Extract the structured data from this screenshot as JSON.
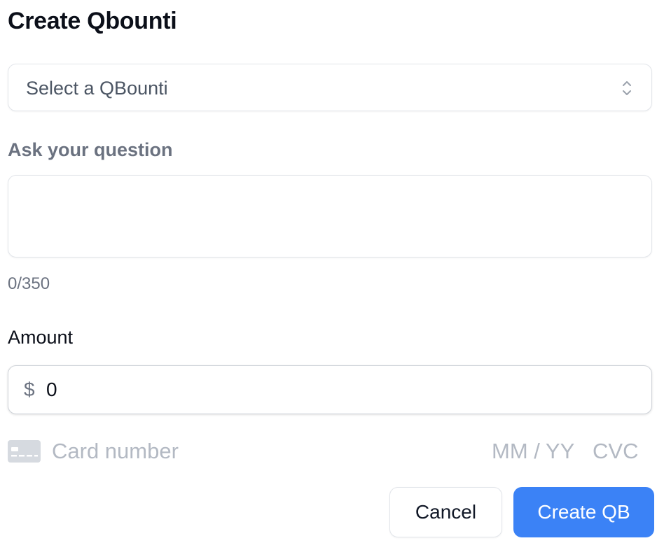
{
  "modal": {
    "title": "Create Qbounti"
  },
  "qbounti_select": {
    "selected": "Select a QBounti",
    "icon": "chevron-up-down-icon"
  },
  "question": {
    "label": "Ask your question",
    "value": "",
    "placeholder": "",
    "counter": "0/350"
  },
  "amount": {
    "label": "Amount",
    "currency_symbol": "$",
    "value": "0"
  },
  "card": {
    "icon": "credit-card-icon",
    "number_placeholder": "Card number",
    "expiry_placeholder": "MM / YY",
    "cvc_placeholder": "CVC"
  },
  "actions": {
    "cancel_label": "Cancel",
    "create_label": "Create QB"
  },
  "colors": {
    "primary": "#3b82f6",
    "placeholder": "#b3b9c3",
    "muted_text": "#6b7280"
  }
}
